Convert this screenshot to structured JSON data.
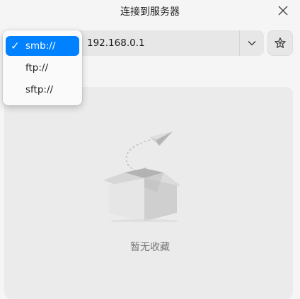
{
  "window": {
    "title": "连接到服务器"
  },
  "address": {
    "value": "192.168.0.1"
  },
  "protocol_menu": {
    "items": [
      {
        "label": "smb://",
        "selected": true
      },
      {
        "label": "ftp://",
        "selected": false
      },
      {
        "label": "sftp://",
        "selected": false
      }
    ]
  },
  "favorites": {
    "empty_text": "暂无收藏"
  },
  "icons": {
    "close": "close-icon",
    "dropdown": "chevron-down-icon",
    "favorite": "star-icon",
    "check": "checkmark-icon",
    "empty": "empty-box-icon"
  },
  "colors": {
    "accent": "#0081ff",
    "background": "#f5f5f5",
    "panel": "#ebebeb"
  }
}
